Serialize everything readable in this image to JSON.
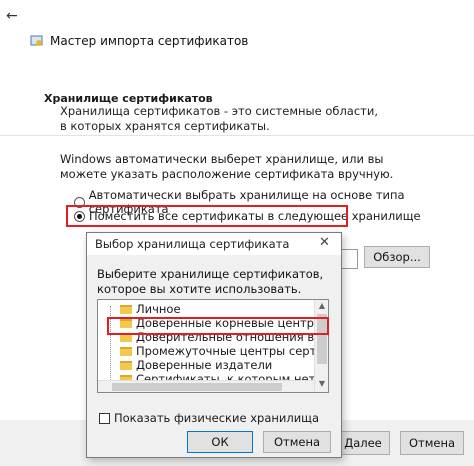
{
  "wizard": {
    "title": "Мастер импорта сертификатов",
    "section_heading": "Хранилище сертификатов",
    "section_desc": "Хранилища сертификатов - это системные области, в которых хранятся сертификаты.",
    "auto_note": "Windows автоматически выберет хранилище, или вы можете указать расположение сертификата вручную.",
    "radio_auto": "Автоматически выбрать хранилище на основе типа сертификата",
    "radio_manual": "Поместить все сертификаты в следующее хранилище",
    "browse_label": "Обзор...",
    "next_label": "Далее",
    "cancel_label": "Отмена"
  },
  "dialog": {
    "title": "Выбор хранилища сертификата",
    "prompt": "Выберите хранилище сертификатов, которое вы хотите использовать.",
    "stores": [
      "Личное",
      "Доверенные корневые центры серти",
      "Доверительные отношения в предпри",
      "Промежуточные центры сертификаци",
      "Доверенные издатели",
      "Сертификаты, к которым нет довере"
    ],
    "show_physical": "Показать физические хранилища",
    "ok_label": "ОК",
    "cancel_label": "Отмена"
  },
  "colors": {
    "highlight": "#e01e25",
    "folder": "#f2c94c"
  }
}
